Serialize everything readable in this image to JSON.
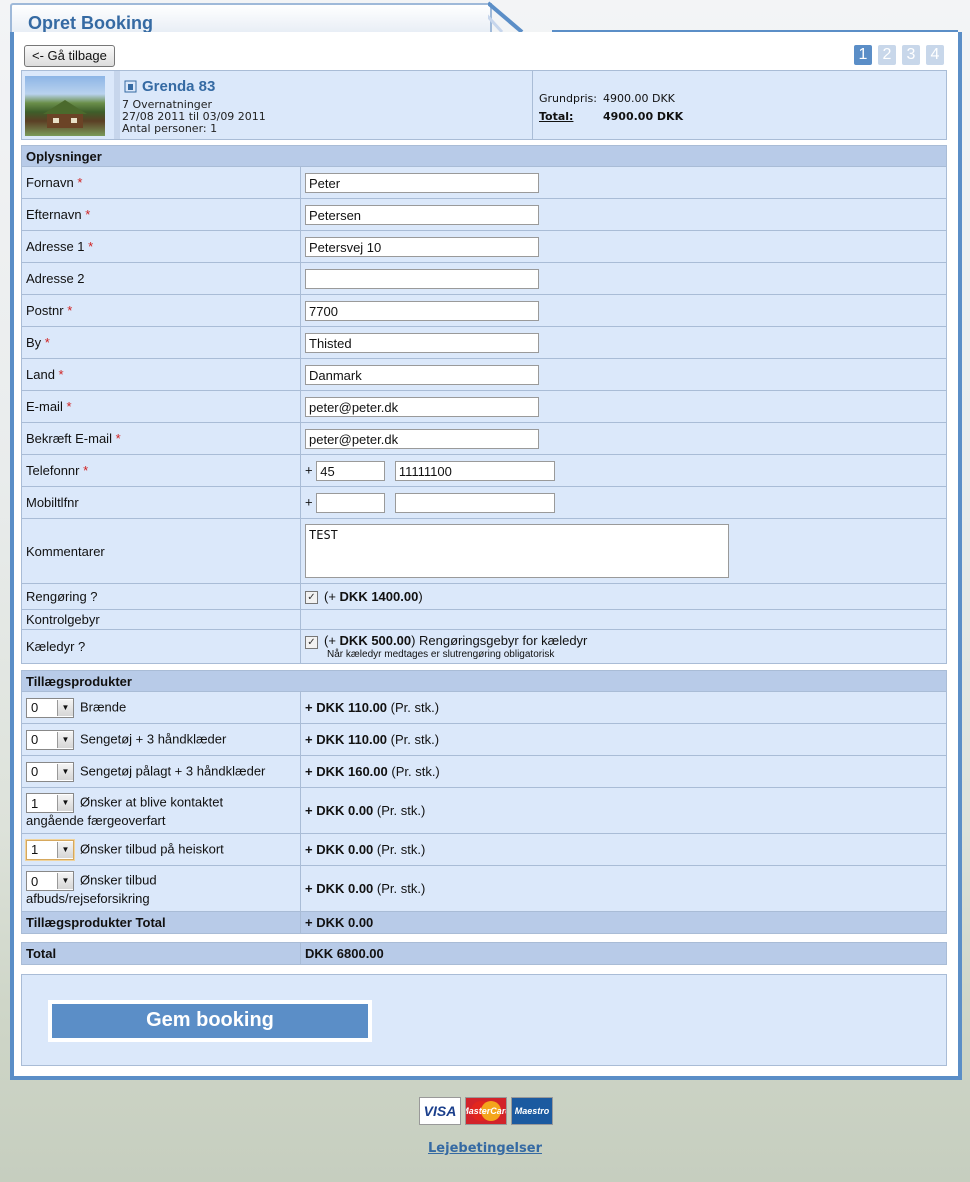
{
  "page": {
    "title": "Opret Booking"
  },
  "nav": {
    "back_label": "<- Gå tilbage",
    "steps": [
      "1",
      "2",
      "3",
      "4"
    ],
    "active_step": "1"
  },
  "summary": {
    "name": "Grenda 83",
    "nights": "7 Overnatninger",
    "dates": "27/08 2011 til 03/09 2011",
    "persons": "Antal personer: 1",
    "base_price_label": "Grundpris:",
    "base_price_value": "4900.00 DKK",
    "total_label": "Total:",
    "total_value": "4900.00 DKK"
  },
  "info": {
    "heading": "Oplysninger",
    "fields": {
      "fornavn": {
        "label": "Fornavn",
        "value": "Peter"
      },
      "efternavn": {
        "label": "Efternavn",
        "value": "Petersen"
      },
      "adresse1": {
        "label": "Adresse 1",
        "value": "Petersvej 10"
      },
      "adresse2": {
        "label": "Adresse 2",
        "value": ""
      },
      "postnr": {
        "label": "Postnr",
        "value": "7700"
      },
      "by": {
        "label": "By",
        "value": "Thisted"
      },
      "land": {
        "label": "Land",
        "value": "Danmark"
      },
      "email": {
        "label": "E-mail",
        "value": "peter@peter.dk"
      },
      "email_confirm": {
        "label": "Bekræft E-mail",
        "value": "peter@peter.dk"
      },
      "telefon": {
        "label": "Telefonnr",
        "prefix": "+",
        "code": "45",
        "number": "11111100"
      },
      "mobil": {
        "label": "Mobiltlfnr",
        "prefix": "+",
        "code": "",
        "number": ""
      },
      "kommentarer": {
        "label": "Kommentarer",
        "value": "TEST"
      }
    },
    "required_mark": "*",
    "cleaning": {
      "label": "Rengøring ?",
      "checked": true,
      "open": "(+ ",
      "price": "DKK 1400.00",
      "close": ")"
    },
    "control_fee": {
      "label": "Kontrolgebyr"
    },
    "pets": {
      "label": "Kæledyr ?",
      "checked": true,
      "open": "(+ ",
      "price": "DKK 500.00",
      "close": ") Rengøringsgebyr for kæledyr",
      "note": "Når kæledyr medtages er slutrengøring obligatorisk"
    }
  },
  "extras": {
    "heading": "Tillægsprodukter",
    "items": [
      {
        "qty": "0",
        "name": "Brænde",
        "price": "+ DKK 110.00",
        "unit": "(Pr. stk.)"
      },
      {
        "qty": "0",
        "name": "Sengetøj + 3 håndklæder",
        "price": "+ DKK 110.00",
        "unit": "(Pr. stk.)"
      },
      {
        "qty": "0",
        "name": "Sengetøj pålagt + 3 håndklæder",
        "price": "+ DKK 160.00",
        "unit": "(Pr. stk.)"
      },
      {
        "qty": "1",
        "name": "Ønsker at blive kontaktet",
        "name2": "angående færgeoverfart",
        "price": "+ DKK 0.00",
        "unit": "(Pr. stk.)"
      },
      {
        "qty": "1",
        "name": "Ønsker tilbud på heiskort",
        "price": "+ DKK 0.00",
        "unit": "(Pr. stk.)"
      },
      {
        "qty": "0",
        "name": "Ønsker tilbud",
        "name2": "afbuds/rejseforsikring",
        "price": "+ DKK 0.00",
        "unit": "(Pr. stk.)"
      }
    ],
    "total_label": "Tillægsprodukter Total",
    "total_value": "+ DKK 0.00"
  },
  "grand_total": {
    "label": "Total",
    "value": "DKK 6800.00"
  },
  "save_label": "Gem booking",
  "payment": {
    "visa": "VISA",
    "mastercard": "MasterCard",
    "maestro": "Maestro"
  },
  "terms_label": "Lejebetingelser",
  "colors": {
    "accent": "#5b8ec7",
    "panel": "#dbe8fa",
    "heading_bg": "#b8cbe8",
    "link": "#356aa3",
    "required": "#d0201f"
  }
}
